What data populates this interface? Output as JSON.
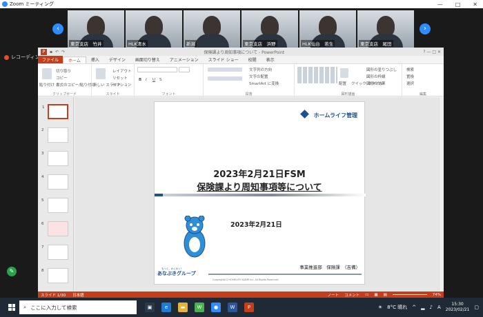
{
  "zoom": {
    "window_title": "Zoom ミーティング",
    "participants": [
      {
        "name": "東京支店　竹井"
      },
      {
        "name": "HLK清水"
      },
      {
        "name": "新潟"
      },
      {
        "name": "東京支店　浜野"
      },
      {
        "name": "HLK仙台　若生"
      },
      {
        "name": "東京支店　尾田"
      }
    ],
    "recording_label": "レコーディング"
  },
  "ppt": {
    "title": "保険課より周知事項について - PowerPoint",
    "tabs": [
      "ファイル",
      "ホーム",
      "挿入",
      "デザイン",
      "画面切り替え",
      "アニメーション",
      "スライド ショー",
      "校閲",
      "表示"
    ],
    "ribbon": {
      "clipboard": {
        "label": "クリップボード",
        "paste": "貼り付け",
        "cut": "切り取り",
        "copy": "コピー",
        "format": "書式のコピー/貼り付け"
      },
      "slides": {
        "label": "スライド",
        "new": "新しい スライド",
        "layout": "レイアウト",
        "reset": "リセット",
        "section": "セクション"
      },
      "font": {
        "label": "フォント"
      },
      "paragraph": {
        "label": "段落",
        "dir": "文字列の方向",
        "align": "文字の配置",
        "smartart": "SmartArt に変換"
      },
      "drawing": {
        "label": "図形描画",
        "arrange": "配置",
        "quick": "クイック スタイル",
        "fill": "図形の塗りつぶし",
        "outline": "図形の枠線",
        "effects": "図形の効果"
      },
      "editing": {
        "label": "編集",
        "find": "検索",
        "replace": "置換",
        "select": "選択"
      }
    },
    "thumb_numbers": [
      "1",
      "2",
      "3",
      "4",
      "5",
      "6",
      "7",
      "8"
    ],
    "slide": {
      "brand": "ホームライフ管理",
      "title_line1": "2023年2月21日FSM",
      "title_line2": "保険課より周知事項等について",
      "date": "2023年2月21日",
      "dept": "事業推進部　保険課　（吉備）",
      "logo_sub": "もっと、わくわく!",
      "logo": "あなぶきグループ",
      "copyright": "Copyright(C) HOMELIFE KANRI Inc. All Rights Reserved"
    },
    "status": {
      "slide_count": "スライド 1/30",
      "language": "日本語",
      "notes": "ノート",
      "comments": "コメント",
      "zoom": "74%"
    }
  },
  "taskbar": {
    "search_placeholder": "ここに入力して検索",
    "weather": "8°C 晴れ",
    "ime": "A",
    "time": "15:30",
    "date": "2023/02/21"
  }
}
